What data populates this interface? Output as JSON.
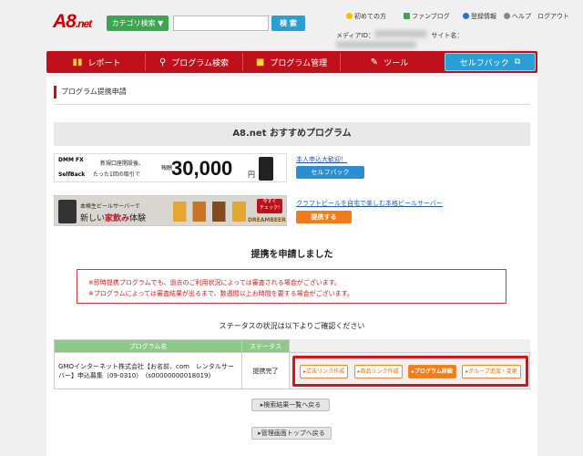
{
  "header": {
    "logo": "A8",
    "logo_suffix": ".net",
    "category_button": "カテゴリ検索 ▼",
    "search_placeholder": "",
    "search_button": "検 索",
    "links": [
      "初めての方",
      "ファンブログ",
      "登録情報",
      "ヘルプ",
      "ログアウト"
    ],
    "media_id_label": "メディアID：",
    "site_name_label": "サイト名："
  },
  "nav": {
    "items": [
      "レポート",
      "プログラム検索",
      "プログラム管理",
      "ツール"
    ],
    "self_back": "セルフバック"
  },
  "page": {
    "title": "プログラム提携申請"
  },
  "recommend": {
    "heading": "A8.net おすすめプログラム",
    "banner1": {
      "brand_top": "DMM FX",
      "brand_bottom": "SelfBack",
      "line1": "新規口座開設後、",
      "line2": "たった1回の取引で",
      "prefix": "報酬",
      "amount": "30,000",
      "unit": "円"
    },
    "banner2": {
      "line1": "本格生ビールサーバーで",
      "line2": "新しい",
      "emph": "家飲み",
      "line2b": "体験",
      "badge": "今すぐ\nチェック!",
      "brand": "DREAMBEER"
    },
    "item1": {
      "link": "本人申込大歓迎！",
      "button": "セルフバック"
    },
    "item2": {
      "link": "クラフトビールを自宅で楽しむ本格ビールサーバー",
      "button": "提携する"
    }
  },
  "result": {
    "message": "提携を申請しました",
    "notice_lines": [
      "※即時提携プログラムでも、過去のご利用状況によっては審査される場合がございます。",
      "※プログラムによっては審査結果が出るまで、数週間以上お時間を要する場合がございます。"
    ],
    "status_note": "ステータスの状況は以下よりご確認ください"
  },
  "table": {
    "headers": [
      "プログラム名",
      "ステータス"
    ],
    "row": {
      "name": "GMOインターネット株式会社【お名前．com　レンタルサーバー】申込募集（09-0310）　(s00000000018019)",
      "status": "提携完了",
      "actions": [
        "▸広告リンク作成",
        "▸商品リンク作成",
        "▸プログラム詳細",
        "▸グループ追加・変更"
      ]
    }
  },
  "footer_buttons": {
    "back_to_results": "▸検索結果一覧へ戻る",
    "back_to_top": "▸管理画面トップへ戻る"
  },
  "colors": {
    "nav_red": "#c0101a",
    "selfback_blue": "#2a9fd6",
    "accent_orange": "#f07d1a",
    "table_header_green": "#8fc88a",
    "highlight_red": "#dd1111"
  }
}
